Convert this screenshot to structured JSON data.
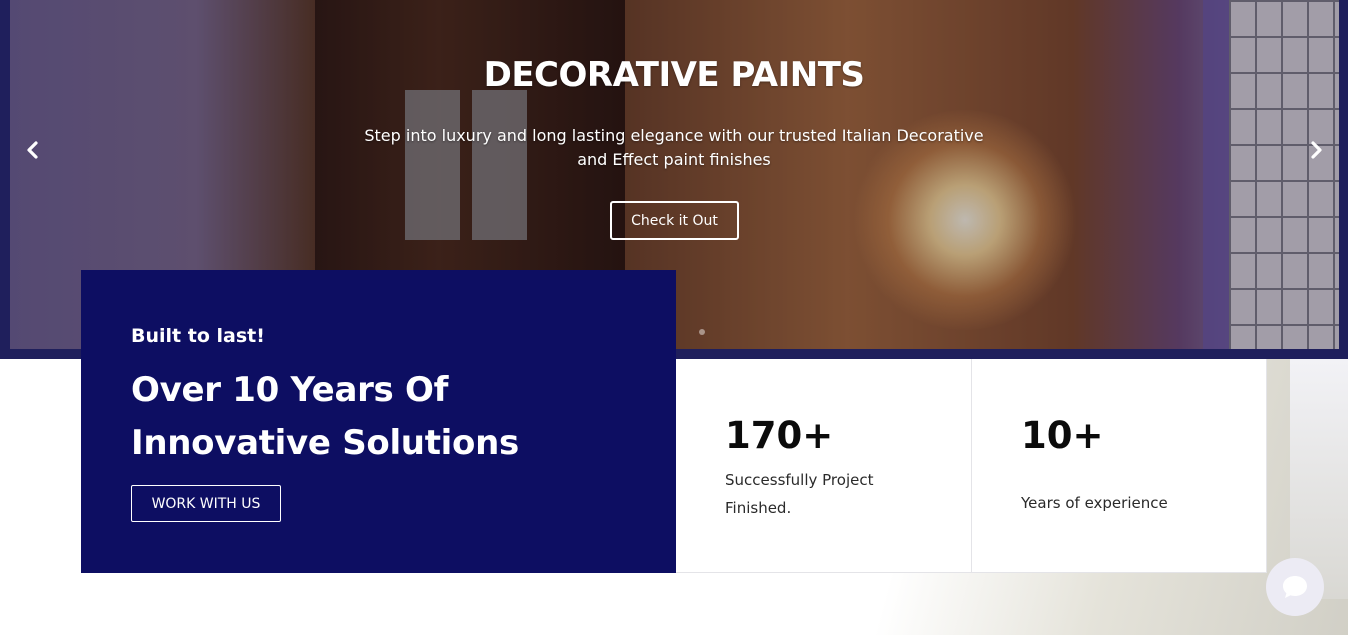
{
  "hero": {
    "title": "DECORATIVE PAINTS",
    "subtitle": "Step into luxury and long lasting elegance with our trusted Italian Decorative and Effect paint finishes",
    "cta_label": "Check it Out",
    "prev_icon": "chevron-left-icon",
    "next_icon": "chevron-right-icon"
  },
  "promo": {
    "kicker": "Built to last!",
    "title": "Over 10 Years Of Innovative Solutions",
    "cta_label": "WORK WITH US"
  },
  "stats": [
    {
      "number": "170+",
      "label": "Successfully Project Finished."
    },
    {
      "number": "10+",
      "label": "Years of experience"
    }
  ],
  "chat": {
    "icon": "chat-icon"
  },
  "colors": {
    "navy": "#0d0e62",
    "slider_frame": "#1f1f5c",
    "white": "#ffffff",
    "divider": "#e4e4e8"
  }
}
